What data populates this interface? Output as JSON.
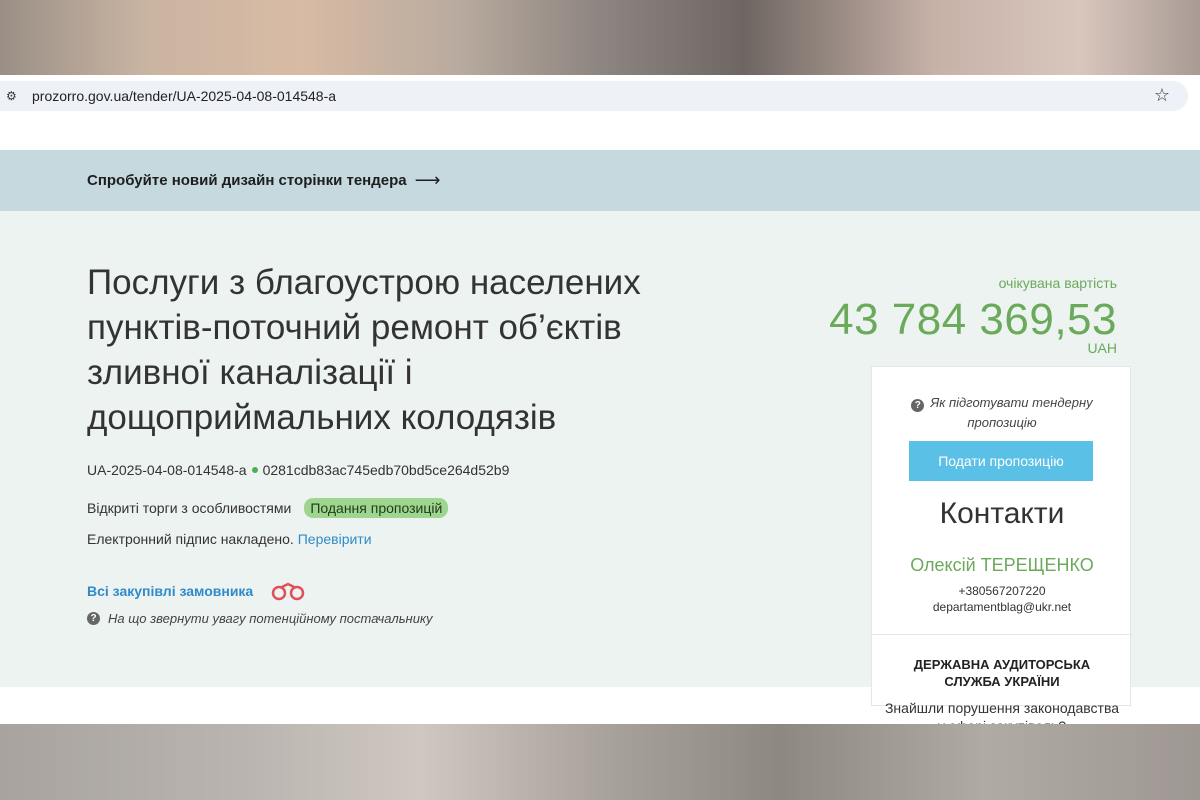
{
  "browser": {
    "url": "prozorro.gov.ua/tender/UA-2025-04-08-014548-a"
  },
  "banner": {
    "text": "Спробуйте новий дизайн сторінки тендера"
  },
  "tender": {
    "title": "Послуги з благоустрою населених пунктів-поточний ремонт об’єктів зливної каналізації і дощоприймальних колодязів",
    "id": "UA-2025-04-08-014548-a",
    "hash": "0281cdb83ac745edb70bd5ce264d52b9",
    "procedure": "Відкриті торги з особливостями",
    "status": "Подання пропозицій",
    "signature_text": "Електронний підпис накладено.",
    "signature_link": "Перевірити",
    "all_purchases_link": "Всі закупівлі замовника",
    "attention_text": "На що звернути увагу потенційному постачальнику"
  },
  "value": {
    "label": "очікувана вартість",
    "amount": "43 784 369,53",
    "currency": "UAH"
  },
  "panel": {
    "howto": "Як підготувати тендерну пропозицію",
    "submit_label": "Подати пропозицію",
    "contacts_title": "Контакти",
    "contact_name": "Олексій ТЕРЕЩЕНКО",
    "contact_phone": "+380567207220",
    "contact_email": "departamentblag@ukr.net",
    "audit_title": "ДЕРЖАВНА АУДИТОРСЬКА СЛУЖБА УКРАЇНИ",
    "audit_text": "Знайшли порушення законодавства у сфері закупівель?"
  },
  "colors": {
    "accent_green": "#6aaa5a",
    "link_blue": "#2f8bc9",
    "button_blue": "#5bc0e6",
    "banner_bg": "#c6d9df",
    "content_bg": "#edf3f1"
  }
}
